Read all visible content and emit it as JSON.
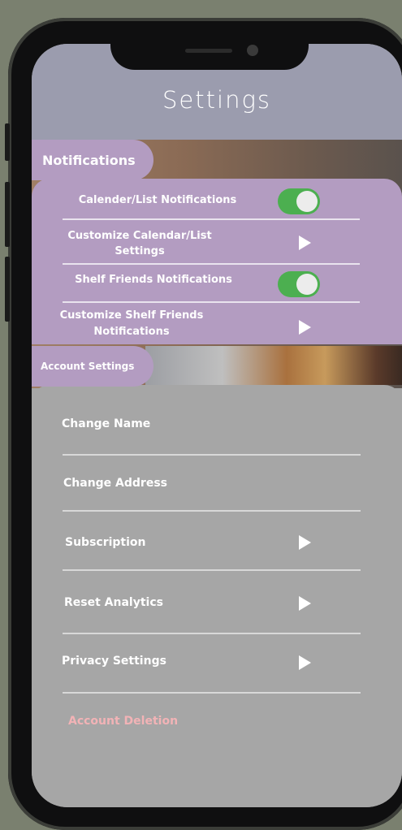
{
  "header": {
    "title": "Settings"
  },
  "notifications": {
    "section_label": "Notifications",
    "items": [
      {
        "label": "Calender/List Notifications",
        "control": "toggle",
        "enabled": true
      },
      {
        "label": "Customize Calendar/List Settings",
        "control": "arrow"
      },
      {
        "label": "Shelf Friends Notifications",
        "control": "toggle",
        "enabled": true
      },
      {
        "label": "Customize Shelf Friends Notifications",
        "control": "arrow"
      }
    ]
  },
  "account": {
    "section_label": "Account Settings",
    "items": [
      {
        "label": "Change Name"
      },
      {
        "label": "Change Address"
      },
      {
        "label": "Subscription",
        "control": "arrow"
      },
      {
        "label": "Reset Analytics",
        "control": "arrow"
      },
      {
        "label": "Privacy Settings",
        "control": "arrow"
      }
    ],
    "deletion_label": "Account Deletion"
  },
  "colors": {
    "header_bg": "#9b9cae",
    "section_bg": "#b39cc1",
    "account_bg": "#a6a6a6",
    "toggle_on": "#4caf50",
    "danger_text": "#f2b3b6"
  },
  "icons": [
    "play-arrow-icon",
    "toggle-switch"
  ]
}
